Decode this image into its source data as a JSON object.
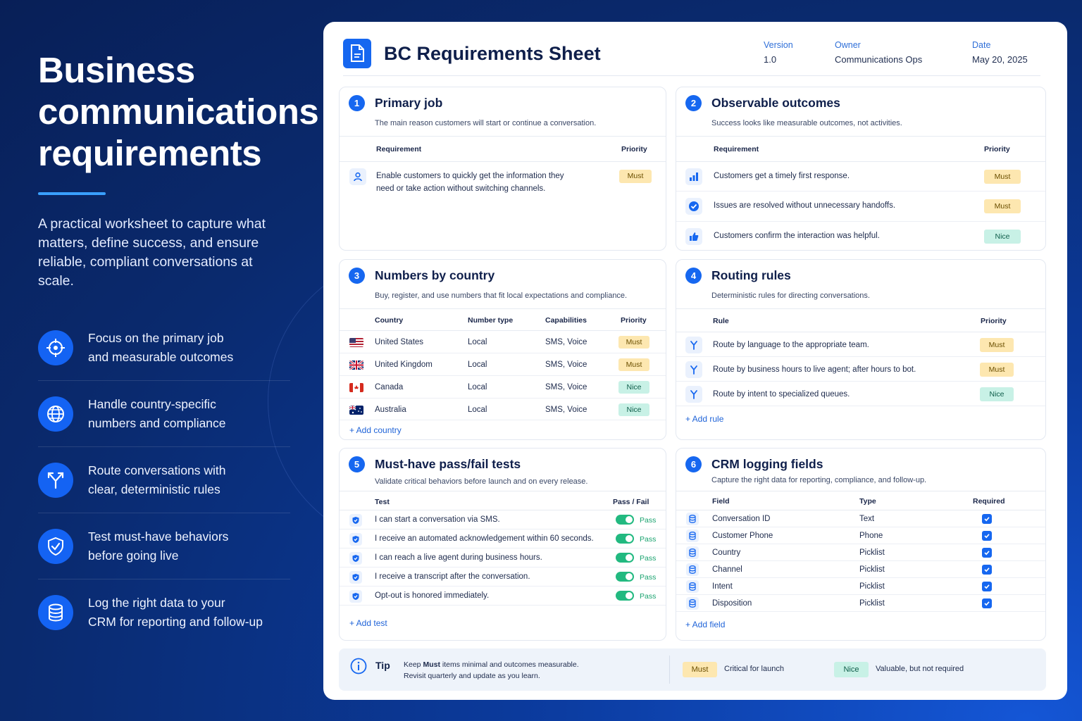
{
  "hero": {
    "title_line1": "Business",
    "title_line2": "communications",
    "title_line3": "requirements",
    "description": "A practical worksheet to capture what matters, define success, and ensure reliable, compliant conversations at scale."
  },
  "features": [
    {
      "icon": "crosshair-icon",
      "line1": "Focus on the primary job",
      "line2": "and measurable outcomes"
    },
    {
      "icon": "globe-icon",
      "line1": "Handle country-specific",
      "line2": "numbers and compliance"
    },
    {
      "icon": "route-split-icon",
      "line1": "Route conversations with",
      "line2": "clear, deterministic rules"
    },
    {
      "icon": "shield-check-icon",
      "line1": "Test must-have behaviors",
      "line2": "before going live"
    },
    {
      "icon": "database-icon",
      "line1": "Log the right data to your",
      "line2": "CRM for reporting and follow-up"
    }
  ],
  "sheet": {
    "title": "BC Requirements Sheet",
    "version_label": "Version",
    "version_value": "1.0",
    "owner_label": "Owner",
    "owner_value": "Communications Ops",
    "date_label": "Date",
    "date_value": "May 20, 2025"
  },
  "colors": {
    "primary": "#1667f0",
    "must_bg": "#fde7b0",
    "nice_bg": "#c8f1e6",
    "pass": "#22b980"
  },
  "primary_job": {
    "num": "1",
    "title": "Primary job",
    "subtitle": "The main reason customers will start or continue a conversation.",
    "col_requirement": "Requirement",
    "col_priority": "Priority",
    "rows": [
      {
        "line1": "Enable customers to quickly get the information they",
        "line2": "need or take action without switching channels.",
        "priority": "Must"
      }
    ]
  },
  "outcomes": {
    "num": "2",
    "title": "Observable outcomes",
    "subtitle": "Success looks like measurable outcomes, not activities.",
    "col_requirement": "Requirement",
    "col_priority": "Priority",
    "rows": [
      {
        "icon": "bar-chart-icon",
        "text": "Customers get a timely first response.",
        "priority": "Must"
      },
      {
        "icon": "check-circle-icon",
        "text": "Issues are resolved without unnecessary handoffs.",
        "priority": "Must"
      },
      {
        "icon": "thumbs-up-icon",
        "text": "Customers confirm the interaction was helpful.",
        "priority": "Nice"
      }
    ]
  },
  "numbers": {
    "num": "3",
    "title": "Numbers by country",
    "subtitle": "Buy, register, and use numbers that fit local expectations and compliance.",
    "col_country": "Country",
    "col_type": "Number type",
    "col_cap": "Capabilities",
    "col_priority": "Priority",
    "rows": [
      {
        "flag": "us-flag-icon",
        "country": "United States",
        "type": "Local",
        "cap": "SMS, Voice",
        "priority": "Must"
      },
      {
        "flag": "uk-flag-icon",
        "country": "United Kingdom",
        "type": "Local",
        "cap": "SMS, Voice",
        "priority": "Must"
      },
      {
        "flag": "canada-flag-icon",
        "country": "Canada",
        "type": "Local",
        "cap": "SMS, Voice",
        "priority": "Nice"
      },
      {
        "flag": "australia-flag-icon",
        "country": "Australia",
        "type": "Local",
        "cap": "SMS, Voice",
        "priority": "Nice"
      }
    ],
    "add_label": "+  Add country"
  },
  "routing": {
    "num": "4",
    "title": "Routing rules",
    "subtitle": "Deterministic rules for directing conversations.",
    "col_rule": "Rule",
    "col_priority": "Priority",
    "rows": [
      {
        "text": "Route by language to the appropriate team.",
        "priority": "Must"
      },
      {
        "text": "Route by business hours to live agent; after hours to bot.",
        "priority": "Must"
      },
      {
        "text": "Route by intent to specialized queues.",
        "priority": "Nice"
      }
    ],
    "add_label": "+  Add rule"
  },
  "tests": {
    "num": "5",
    "title": "Must-have pass/fail tests",
    "subtitle": "Validate critical behaviors before launch and on every release.",
    "col_test": "Test",
    "col_pass": "Pass / Fail",
    "rows": [
      {
        "text": "I can start a conversation via SMS.",
        "result": "Pass"
      },
      {
        "text": "I receive an automated acknowledgement within 60 seconds.",
        "result": "Pass"
      },
      {
        "text": "I can reach a live agent during business hours.",
        "result": "Pass"
      },
      {
        "text": "I receive a transcript after the conversation.",
        "result": "Pass"
      },
      {
        "text": "Opt-out is honored immediately.",
        "result": "Pass"
      }
    ],
    "add_label": "+  Add test"
  },
  "crm": {
    "num": "6",
    "title": "CRM logging fields",
    "subtitle": "Capture the right data for reporting, compliance, and follow-up.",
    "col_field": "Field",
    "col_type": "Type",
    "col_required": "Required",
    "rows": [
      {
        "field": "Conversation ID",
        "type": "Text"
      },
      {
        "field": "Customer Phone",
        "type": "Phone"
      },
      {
        "field": "Country",
        "type": "Picklist"
      },
      {
        "field": "Channel",
        "type": "Picklist"
      },
      {
        "field": "Intent",
        "type": "Picklist"
      },
      {
        "field": "Disposition",
        "type": "Picklist"
      }
    ],
    "add_label": "+  Add field"
  },
  "tip": {
    "label": "Tip",
    "line1_pre": "Keep ",
    "line1_bold": "Must",
    "line1_post": " items minimal and outcomes measurable.",
    "line2": "Revisit quarterly and update as you learn.",
    "must_badge": "Must",
    "must_desc": "Critical for launch",
    "nice_badge": "Nice",
    "nice_desc": "Valuable, but not required"
  }
}
